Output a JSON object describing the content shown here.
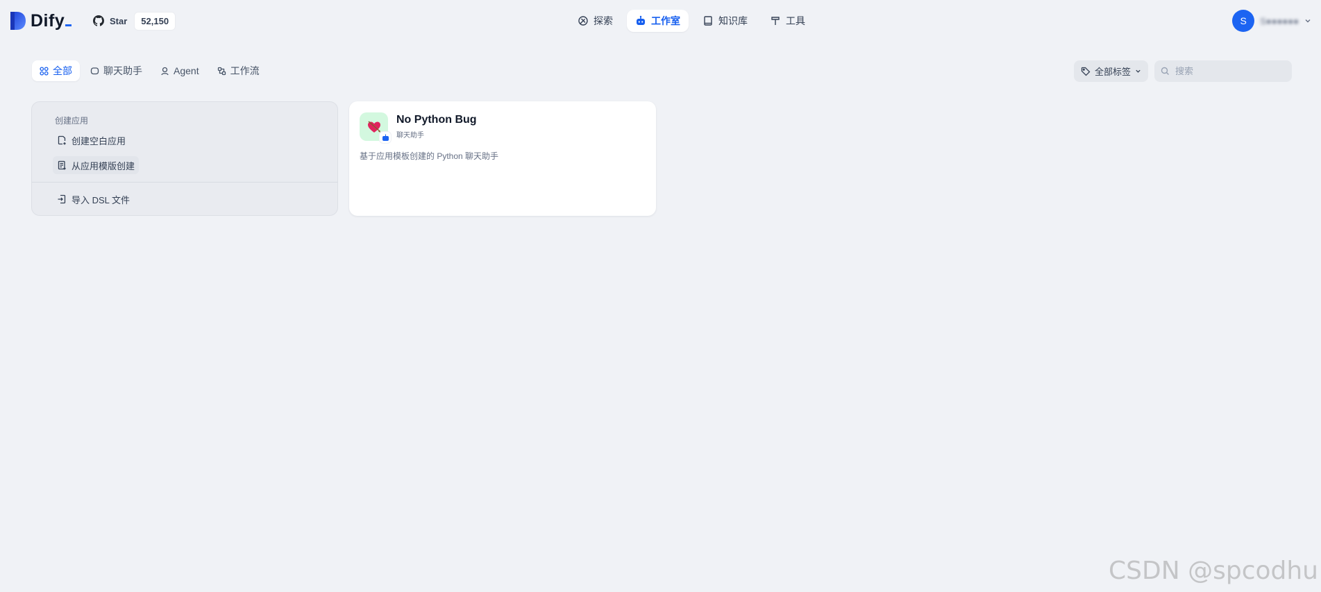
{
  "header": {
    "logo_text": "Dify",
    "github": {
      "star_label": "Star",
      "star_count": "52,150"
    },
    "nav": [
      {
        "label": "探索",
        "icon": "compass-icon",
        "active": false
      },
      {
        "label": "工作室",
        "icon": "robot-icon",
        "active": true
      },
      {
        "label": "知识库",
        "icon": "book-icon",
        "active": false
      },
      {
        "label": "工具",
        "icon": "hammer-icon",
        "active": false
      }
    ],
    "user": {
      "avatar_initial": "S",
      "name": "S●●●●●●"
    }
  },
  "tabs": [
    {
      "label": "全部",
      "icon": "grid-icon",
      "active": true
    },
    {
      "label": "聊天助手",
      "icon": "chat-icon",
      "active": false
    },
    {
      "label": "Agent",
      "icon": "agent-icon",
      "active": false
    },
    {
      "label": "工作流",
      "icon": "workflow-icon",
      "active": false
    }
  ],
  "filters": {
    "tag_label": "全部标签",
    "search_placeholder": "搜索"
  },
  "create_card": {
    "title": "创建应用",
    "items": [
      {
        "label": "创建空白应用",
        "icon": "file-plus-icon"
      },
      {
        "label": "从应用模版创建",
        "icon": "template-icon"
      },
      {
        "label": "导入 DSL 文件",
        "icon": "import-icon"
      }
    ]
  },
  "apps": [
    {
      "name": "No Python Bug",
      "type": "聊天助手",
      "description": "基于应用模板创建的 Python 聊天助手",
      "icon": "heart-arrow-icon",
      "icon_bg": "#d3f8df"
    }
  ],
  "watermark": "CSDN @spcodhu",
  "colors": {
    "accent": "#155eef",
    "background": "#f0f2f6"
  }
}
